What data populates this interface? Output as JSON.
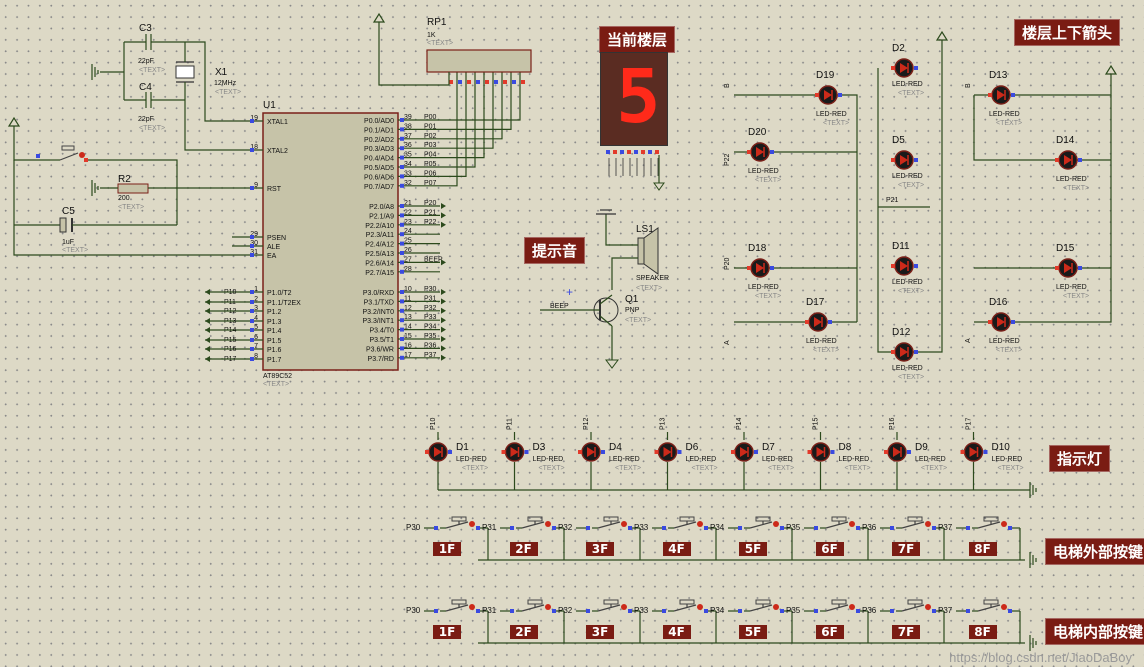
{
  "labels": {
    "current_floor": "当前楼层",
    "floor_arrows": "楼层上下箭头",
    "beep_sound": "提示音",
    "indicator": "指示灯",
    "outside_buttons": "电梯外部按键",
    "inside_buttons": "电梯内部按键"
  },
  "display": {
    "digit": "5"
  },
  "watermark": "https://blog.csdn.net/JiaoDaBoy",
  "mcu": {
    "ref": "U1",
    "part": "AT89C52",
    "text": "<TEXT>",
    "left_pins": [
      {
        "name": "XTAL1",
        "num": "19"
      },
      {
        "name": "XTAL2",
        "num": "18"
      },
      {
        "name": "RST",
        "num": "9"
      },
      {
        "name": "PSEN",
        "num": "29"
      },
      {
        "name": "ALE",
        "num": "30"
      },
      {
        "name": "EA",
        "num": "31"
      },
      {
        "name": "P1.0/T2",
        "num": "1",
        "net": "P10"
      },
      {
        "name": "P1.1/T2EX",
        "num": "2",
        "net": "P11"
      },
      {
        "name": "P1.2",
        "num": "3",
        "net": "P12"
      },
      {
        "name": "P1.3",
        "num": "4",
        "net": "P13"
      },
      {
        "name": "P1.4",
        "num": "5",
        "net": "P14"
      },
      {
        "name": "P1.5",
        "num": "6",
        "net": "P15"
      },
      {
        "name": "P1.6",
        "num": "7",
        "net": "P16"
      },
      {
        "name": "P1.7",
        "num": "8",
        "net": "P17"
      }
    ],
    "right_pins": [
      {
        "name": "P0.0/AD0",
        "num": "39",
        "net": "P00"
      },
      {
        "name": "P0.1/AD1",
        "num": "38",
        "net": "P01"
      },
      {
        "name": "P0.2/AD2",
        "num": "37",
        "net": "P02"
      },
      {
        "name": "P0.3/AD3",
        "num": "36",
        "net": "P03"
      },
      {
        "name": "P0.4/AD4",
        "num": "35",
        "net": "P04"
      },
      {
        "name": "P0.5/AD5",
        "num": "34",
        "net": "P05"
      },
      {
        "name": "P0.6/AD6",
        "num": "33",
        "net": "P06"
      },
      {
        "name": "P0.7/AD7",
        "num": "32",
        "net": "P07"
      },
      {
        "name": "P2.0/A8",
        "num": "21",
        "net": "P20"
      },
      {
        "name": "P2.1/A9",
        "num": "22",
        "net": "P21"
      },
      {
        "name": "P2.2/A10",
        "num": "23",
        "net": "P22"
      },
      {
        "name": "P2.3/A11",
        "num": "24",
        "net": ""
      },
      {
        "name": "P2.4/A12",
        "num": "25",
        "net": ""
      },
      {
        "name": "P2.5/A13",
        "num": "26",
        "net": ""
      },
      {
        "name": "P2.6/A14",
        "num": "27",
        "net": "BEEP"
      },
      {
        "name": "P2.7/A15",
        "num": "28",
        "net": ""
      },
      {
        "name": "P3.0/RXD",
        "num": "10",
        "net": "P30"
      },
      {
        "name": "P3.1/TXD",
        "num": "11",
        "net": "P31"
      },
      {
        "name": "P3.2/INT0",
        "num": "12",
        "net": "P32"
      },
      {
        "name": "P3.3/INT1",
        "num": "13",
        "net": "P33"
      },
      {
        "name": "P3.4/T0",
        "num": "14",
        "net": "P34"
      },
      {
        "name": "P3.5/T1",
        "num": "15",
        "net": "P35"
      },
      {
        "name": "P3.6/WR",
        "num": "16",
        "net": "P36"
      },
      {
        "name": "P3.7/RD",
        "num": "17",
        "net": "P37"
      }
    ]
  },
  "parts": {
    "c3": {
      "ref": "C3",
      "val": "22pF",
      "text": "<TEXT>"
    },
    "c4": {
      "ref": "C4",
      "val": "22pF",
      "text": "<TEXT>"
    },
    "x1": {
      "ref": "X1",
      "val": "12MHz",
      "text": "<TEXT>"
    },
    "r2": {
      "ref": "R2",
      "val": "200",
      "text": "<TEXT>"
    },
    "c5": {
      "ref": "C5",
      "val": "1uF",
      "text": "<TEXT>"
    },
    "rp1": {
      "ref": "RP1",
      "val": "1K",
      "text": "<TEXT>"
    },
    "ls1": {
      "ref": "LS1",
      "val": "SPEAKER",
      "text": "<TEXT>"
    },
    "q1": {
      "ref": "Q1",
      "val": "PNP",
      "text": "<TEXT>",
      "beep": "BEEP"
    }
  },
  "led_type": "LED-RED",
  "text_placeholder": "<TEXT>",
  "indicator_leds": [
    {
      "ref": "D1",
      "net": "P10"
    },
    {
      "ref": "D3",
      "net": "P11"
    },
    {
      "ref": "D4",
      "net": "P12"
    },
    {
      "ref": "D6",
      "net": "P13"
    },
    {
      "ref": "D7",
      "net": "P14"
    },
    {
      "ref": "D8",
      "net": "P15"
    },
    {
      "ref": "D9",
      "net": "P16"
    },
    {
      "ref": "D10",
      "net": "P17"
    }
  ],
  "arrow_group1": [
    {
      "ref": "D19"
    },
    {
      "ref": "D20"
    },
    {
      "ref": "D18"
    },
    {
      "ref": "D17"
    }
  ],
  "arrow_group1_nets": {
    "top": "B",
    "mid": "P22",
    "bot_mid": "P20",
    "bot": "A"
  },
  "arrow_group2": [
    {
      "ref": "D2"
    },
    {
      "ref": "D5"
    },
    {
      "ref": "D11"
    },
    {
      "ref": "D12"
    }
  ],
  "arrow_group2_net": "P21",
  "arrow_group3": [
    {
      "ref": "D13"
    },
    {
      "ref": "D14"
    },
    {
      "ref": "D15"
    },
    {
      "ref": "D16"
    }
  ],
  "arrow_group3_nets": {
    "top": "B",
    "bot": "A"
  },
  "button_nets": [
    "P30",
    "P31",
    "P32",
    "P33",
    "P34",
    "P35",
    "P36",
    "P37"
  ],
  "floors": [
    "1F",
    "2F",
    "3F",
    "4F",
    "5F",
    "6F",
    "7F",
    "8F"
  ]
}
